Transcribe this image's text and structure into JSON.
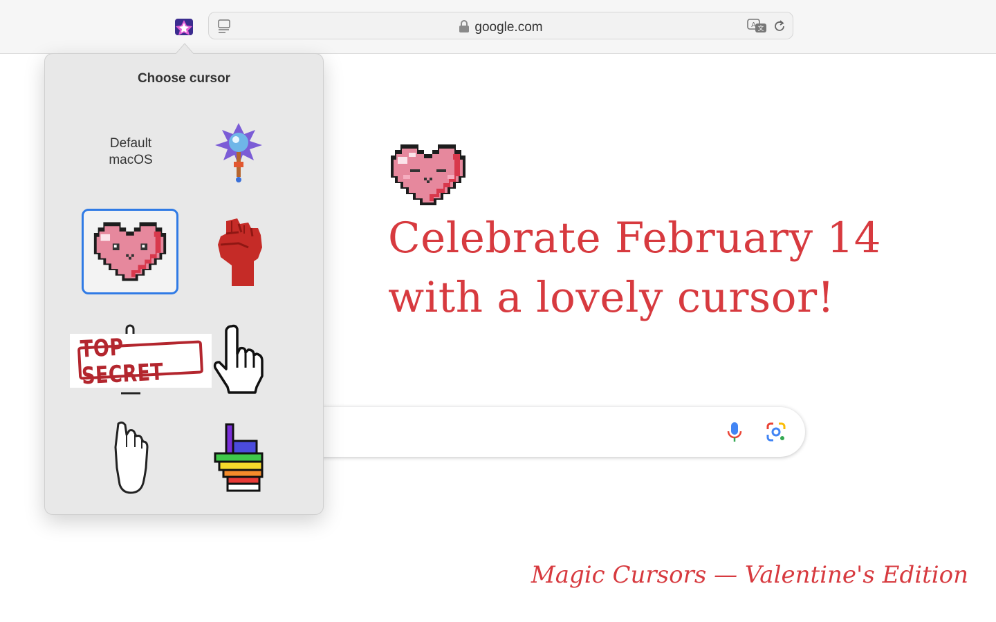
{
  "browser": {
    "url": "google.com",
    "icons": {
      "extension": "magic-cursors-extension-icon",
      "reader": "reader-view-icon",
      "lock": "lock-icon",
      "translate": "translate-icon",
      "reload": "reload-icon"
    }
  },
  "popup": {
    "title": "Choose cursor",
    "options": [
      {
        "label_line1": "Default",
        "label_line2": "macOS",
        "icon": null
      },
      {
        "icon": "magic-staff-icon"
      },
      {
        "icon": "pixel-heart-icon",
        "selected": true
      },
      {
        "icon": "raised-fist-icon"
      },
      {
        "icon": "top-secret-stamp",
        "stamp_text": "TOP SECRET"
      },
      {
        "icon": "pointing-hand-icon"
      },
      {
        "icon": "foot-icon"
      },
      {
        "icon": "rainbow-hand-icon"
      }
    ]
  },
  "page": {
    "headline": "Celebrate February 14 with a lovely cursor!",
    "footer": "Magic Cursors — Valentine's Edition",
    "accent_color": "#d73a3f",
    "search_icons": [
      "microphone-icon",
      "google-lens-icon"
    ]
  }
}
